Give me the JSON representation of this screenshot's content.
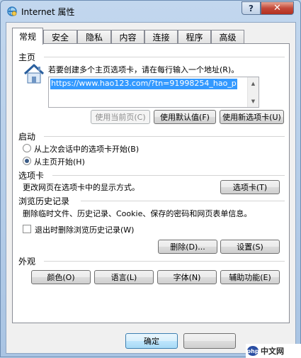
{
  "window": {
    "title": "Internet 属性",
    "help_glyph": "?",
    "close_glyph": "✕"
  },
  "tabs": [
    {
      "label": "常规",
      "active": true
    },
    {
      "label": "安全"
    },
    {
      "label": "隐私"
    },
    {
      "label": "内容"
    },
    {
      "label": "连接"
    },
    {
      "label": "程序"
    },
    {
      "label": "高级"
    }
  ],
  "home": {
    "group_label": "主页",
    "description": "若要创建多个主页选项卡，请在每行输入一个地址(R)。",
    "url": "https://www.hao123.com/?tn=91998254_hao_p",
    "use_current": "使用当前页(C)",
    "use_default": "使用默认值(F)",
    "use_new_tab": "使用新选项卡(U)"
  },
  "startup": {
    "group_label": "启动",
    "option_last_session": "从上次会话中的选项卡开始(B)",
    "option_home": "从主页开始(H)",
    "selected": "home"
  },
  "tabs_section": {
    "group_label": "选项卡",
    "description": "更改网页在选项卡中的显示方式。",
    "button": "选项卡(T)"
  },
  "history": {
    "group_label": "浏览历史记录",
    "description": "删除临时文件、历史记录、Cookie、保存的密码和网页表单信息。",
    "checkbox_label": "退出时删除浏览历史记录(W)",
    "checked": false,
    "delete_button": "删除(D)...",
    "settings_button": "设置(S)"
  },
  "appearance": {
    "group_label": "外观",
    "colors": "颜色(O)",
    "languages": "语言(L)",
    "fonts": "字体(N)",
    "accessibility": "辅助功能(E)"
  },
  "footer": {
    "ok": "确定",
    "cancel": ""
  },
  "watermark": {
    "logo": "php",
    "text": "中文网"
  }
}
